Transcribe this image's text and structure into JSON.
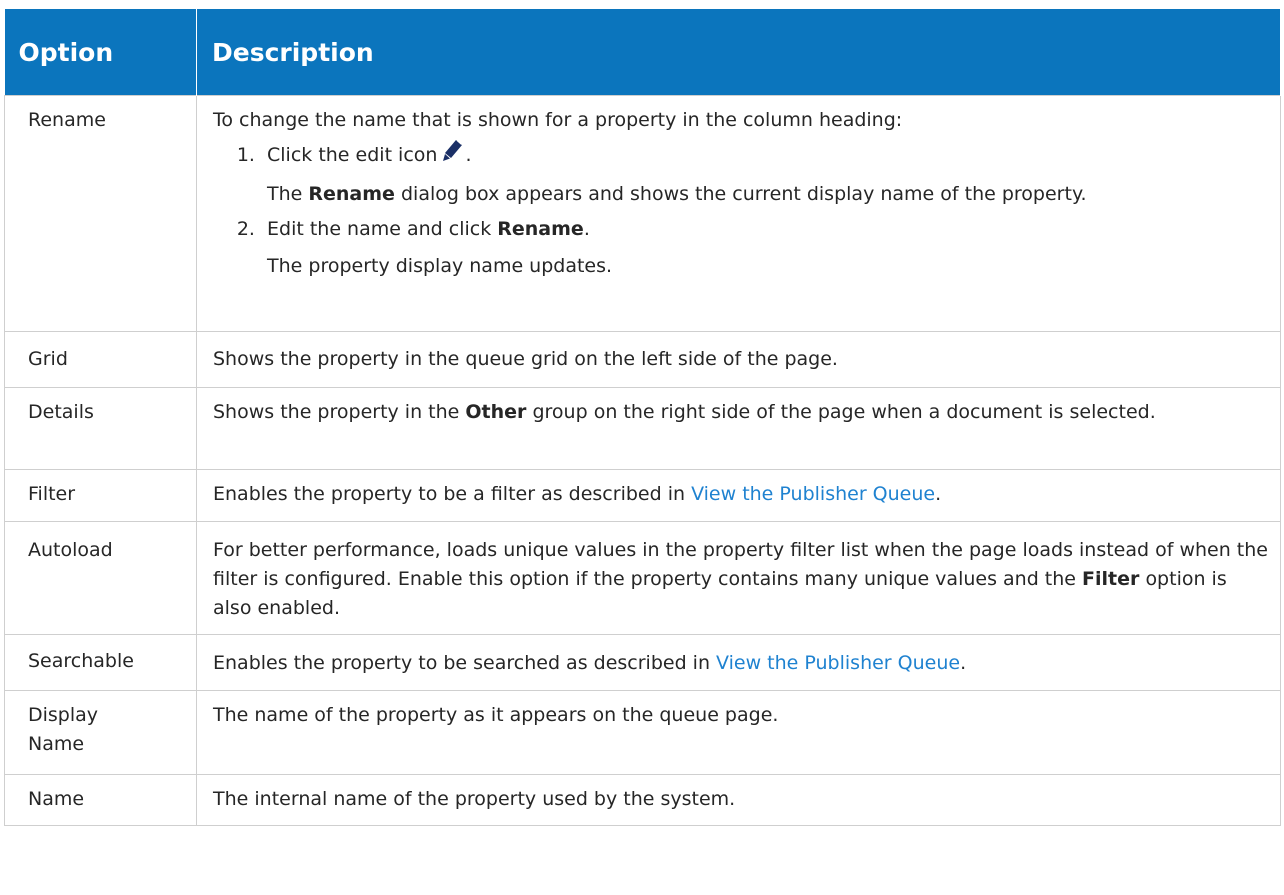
{
  "header": {
    "col_option": "Option",
    "col_description": "Description"
  },
  "rows": {
    "rename": {
      "option": "Rename",
      "intro": "To change the name that is shown for a property in the column heading:",
      "step1_prefix": "Click the edit icon",
      "step1_suffix": ".",
      "step1_note_prefix": "The",
      "step1_note_bold": "Rename",
      "step1_note_suffix": "dialog box appears and shows the current display name of the property.",
      "step2_prefix": "Edit the name and click",
      "step2_bold": "Rename",
      "step2_suffix": ".",
      "step2_note": "The property display name updates.",
      "icon": "edit-pencil-icon"
    },
    "grid": {
      "option": "Grid",
      "description": "Shows the property in the queue grid on the left side of the page."
    },
    "details": {
      "option": "Details",
      "desc_prefix": "Shows the property in the",
      "desc_bold": "Other",
      "desc_suffix": "group on the right side of the page when a document is selected."
    },
    "filter": {
      "option": "Filter",
      "desc_prefix": "Enables the property to be a filter as described in",
      "link": "View the Publisher Queue",
      "desc_suffix": "."
    },
    "autoload": {
      "option": "Autoload",
      "desc_prefix": "For better performance, loads unique values in the property filter list when the page loads instead of when the filter is configured. Enable this option if the property contains many unique values and the",
      "desc_bold": "Filter",
      "desc_suffix": "option is also enabled."
    },
    "searchable": {
      "option": "Searchable",
      "desc_prefix": "Enables the property to be searched as described in",
      "link": "View the Publisher Queue",
      "desc_suffix": "."
    },
    "display_name": {
      "option": "Display Name",
      "description": "The name of the property as it appears on the queue page."
    },
    "name": {
      "option": "Name",
      "description": "The internal name of the property used by the system."
    }
  },
  "colors": {
    "header_bg": "#0b75bd",
    "link": "#1f82d0",
    "border": "#cfcfcf"
  }
}
